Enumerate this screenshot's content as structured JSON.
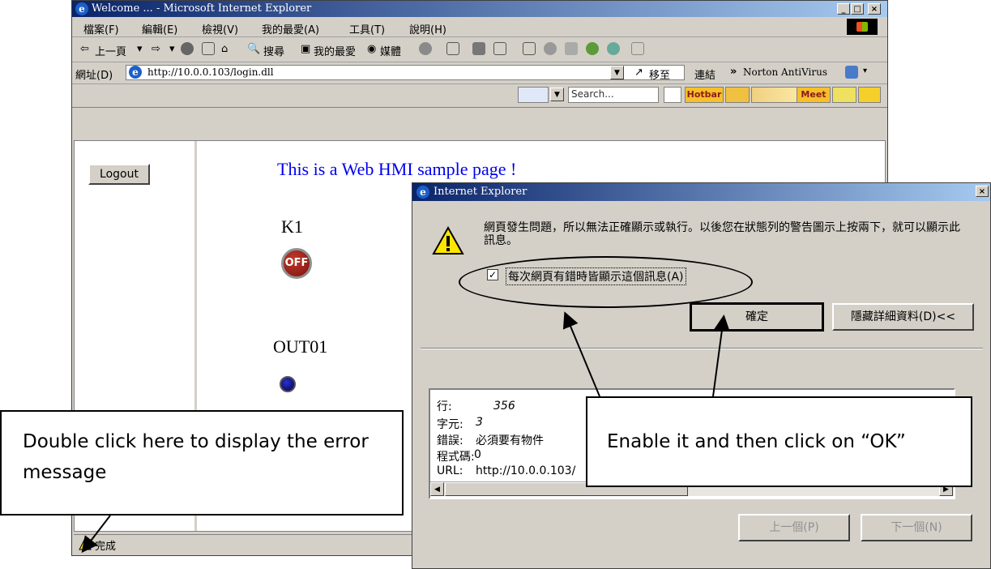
{
  "ie_window": {
    "title": "Welcome ... - Microsoft Internet Explorer",
    "controls": [
      "_",
      "□",
      "×"
    ]
  },
  "menubar": {
    "items": [
      "檔案(F)",
      "編輯(E)",
      "檢視(V)",
      "我的最愛(A)",
      "工具(T)",
      "說明(H)"
    ]
  },
  "toolbar": {
    "back_label": "上一頁",
    "search_label": "搜尋",
    "favorites_label": "我的最愛",
    "media_label": "媒體",
    "go_label": "移至",
    "links_label": "連結",
    "antivirus_label": "Norton AntiVirus"
  },
  "addressbar": {
    "label": "網址(D)",
    "url": "http://10.0.0.103/login.dll"
  },
  "searchbar": {
    "placeholder": "Search...",
    "hotbar_label": "Hotbar",
    "meet_label": "Meet"
  },
  "page": {
    "logout_label": "Logout",
    "heading": "This is a Web HMI sample page !",
    "k1_label": "K1",
    "k1_button_text": "OFF",
    "out01_label": "OUT01"
  },
  "statusbar": {
    "text": "完成"
  },
  "dialog": {
    "title": "Internet Explorer",
    "message": "網頁發生問題，所以無法正確顯示或執行。以後您在狀態列的警告圖示上按兩下，就可以顯示此訊息。",
    "checkbox_label": "每次網頁有錯時皆顯示這個訊息(A)",
    "checkbox_checked": true,
    "ok_label": "確定",
    "hide_details_label": "隱藏詳細資料(D)<<",
    "details": [
      {
        "key": "行:",
        "value": "356"
      },
      {
        "key": "字元:",
        "value": "3"
      },
      {
        "key": "錯誤:",
        "value": "必須要有物件"
      },
      {
        "key": "程式碼:",
        "value": "0"
      },
      {
        "key": "URL:",
        "value": "http://10.0.0.103/"
      }
    ],
    "prev_label": "上一個(P)",
    "next_label": "下一個(N)"
  },
  "annotations": {
    "left_callout": "Double click here to display the error message",
    "right_callout": "Enable it and then click on “OK”"
  },
  "colors": {
    "titlebar_start": "#0a246a",
    "titlebar_end": "#a6caf0",
    "heading_link": "#0000ee",
    "window_face": "#d4d0c8"
  }
}
